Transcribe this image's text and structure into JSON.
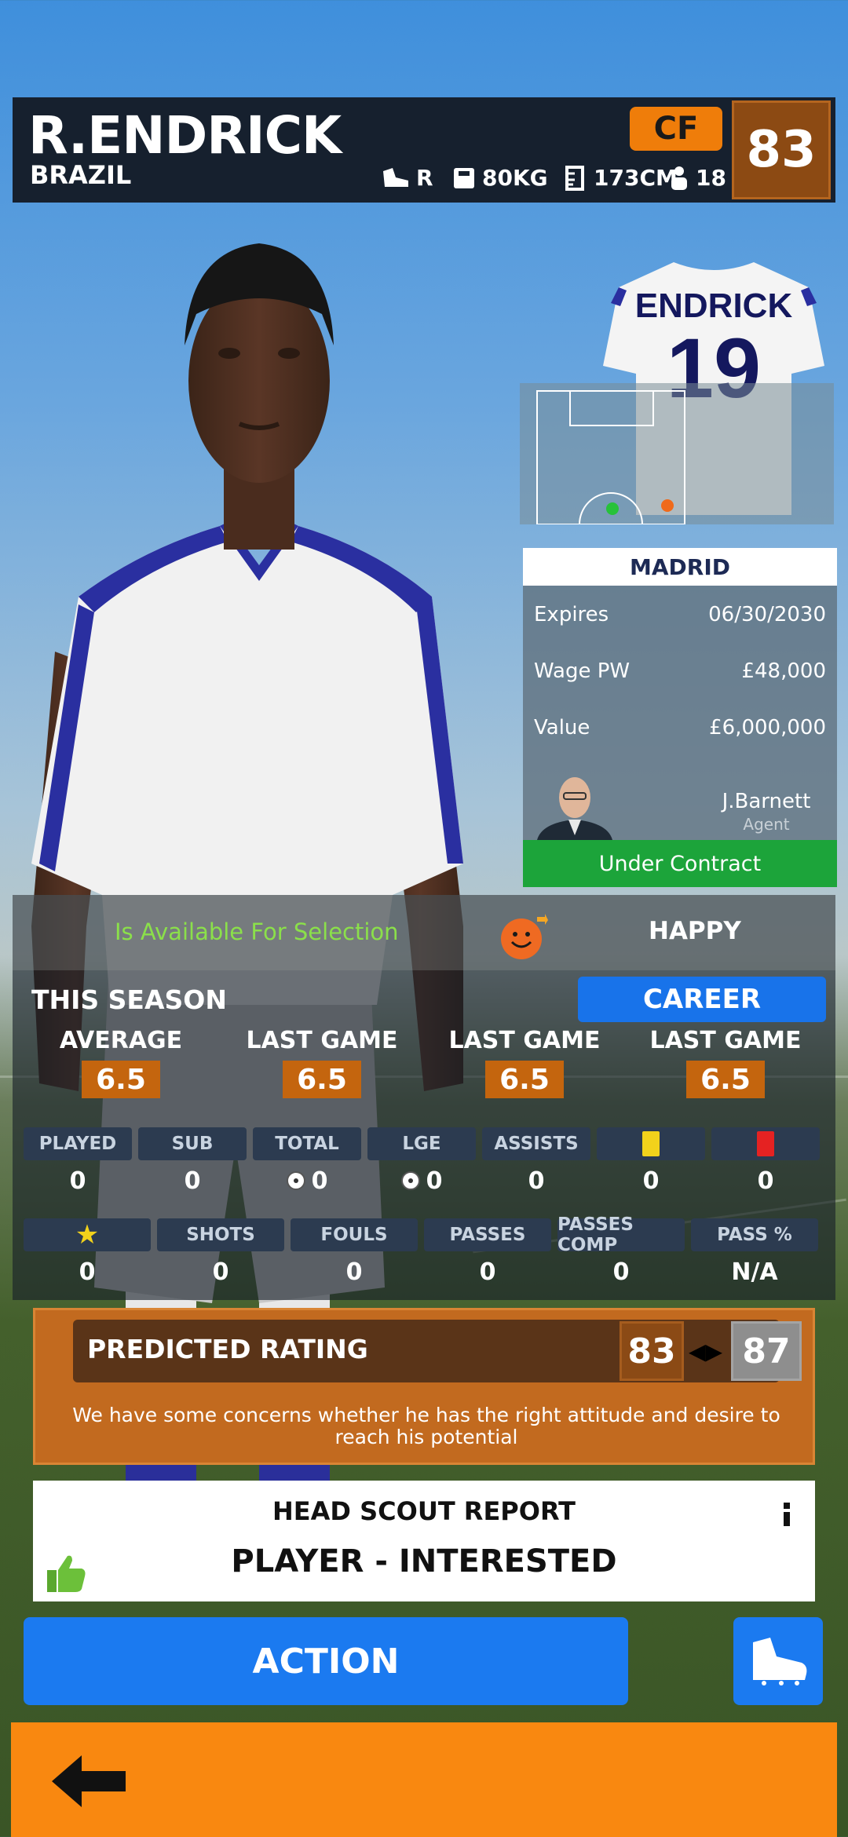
{
  "player": {
    "name": "R.ENDRICK",
    "nation": "BRAZIL",
    "foot": "R",
    "weight": "80KG",
    "height": "173CM",
    "age": "18",
    "position": "CF",
    "rating": "83"
  },
  "shirt": {
    "name": "ENDRICK",
    "number": "19"
  },
  "contract": {
    "club": "MADRID",
    "rows": [
      {
        "label": "Expires",
        "value": "06/30/2030"
      },
      {
        "label": "Wage PW",
        "value": "£48,000"
      },
      {
        "label": "Value",
        "value": "£6,000,000"
      }
    ],
    "agent_name": "J.Barnett",
    "agent_role": "Agent",
    "status": "Under Contract"
  },
  "availability": {
    "text": "Is Available For Selection",
    "mood": "HAPPY",
    "mood_icon": "smiley-face-icon"
  },
  "season": {
    "title": "THIS SEASON",
    "career_label": "CAREER",
    "averages": [
      {
        "label": "AVERAGE",
        "value": "6.5"
      },
      {
        "label": "LAST GAME",
        "value": "6.5"
      },
      {
        "label": "LAST GAME",
        "value": "6.5"
      },
      {
        "label": "LAST GAME",
        "value": "6.5"
      }
    ],
    "row1": [
      {
        "label": "PLAYED",
        "value": "0"
      },
      {
        "label": "SUB",
        "value": "0"
      },
      {
        "label": "TOTAL",
        "value": "0",
        "icon": "ball"
      },
      {
        "label": "LGE",
        "value": "0",
        "icon": "ball"
      },
      {
        "label": "ASSISTS",
        "value": "0"
      },
      {
        "label": "",
        "value": "0",
        "icon": "yellow-card"
      },
      {
        "label": "",
        "value": "0",
        "icon": "red-card"
      }
    ],
    "row2": [
      {
        "label": "",
        "value": "0",
        "icon": "star"
      },
      {
        "label": "SHOTS",
        "value": "0"
      },
      {
        "label": "FOULS",
        "value": "0"
      },
      {
        "label": "PASSES",
        "value": "0"
      },
      {
        "label": "PASSES COMP",
        "value": "0"
      },
      {
        "label": "PASS %",
        "value": "N/A"
      }
    ]
  },
  "prediction": {
    "label": "PREDICTED RATING",
    "low": "83",
    "high": "87",
    "text": "We have some concerns whether he has the right attitude and desire to reach his potential"
  },
  "scout": {
    "title": "HEAD SCOUT REPORT",
    "result": "PLAYER - INTERESTED"
  },
  "actions": {
    "action_label": "ACTION"
  },
  "colors": {
    "accent_blue": "#1b7af0",
    "orange": "#f98810",
    "green": "#1ca43a",
    "header": "#16202e"
  }
}
